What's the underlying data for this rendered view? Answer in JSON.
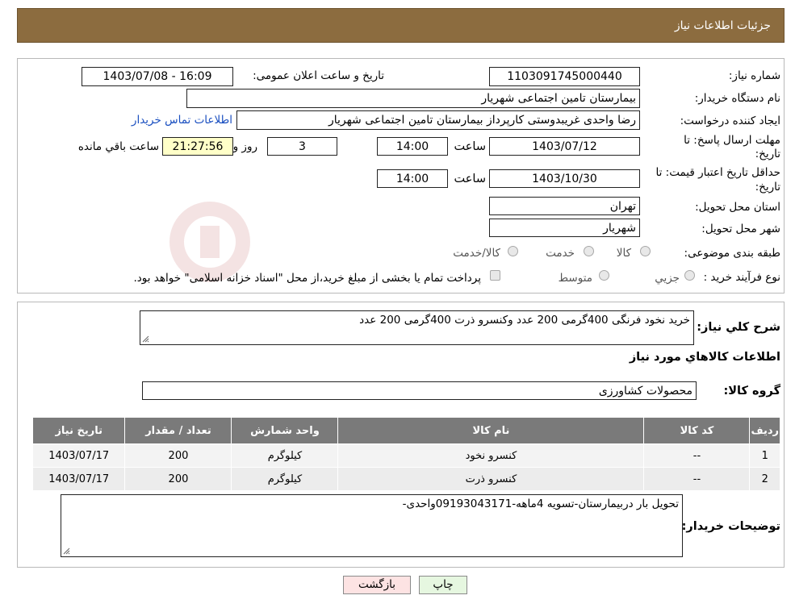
{
  "header": {
    "title": "جزئیات اطلاعات نیاز"
  },
  "form": {
    "need_number_label": "شماره نیاز:",
    "need_number": "1103091745000440",
    "announce_label": "تاریخ و ساعت اعلان عمومی:",
    "announce_value": "1403/07/08 - 16:09",
    "buyer_org_label": "نام دستگاه خریدار:",
    "buyer_org": "بیمارستان تامین اجتماعی شهریار",
    "creator_label": "ایجاد کننده درخواست:",
    "creator": "رضا واحدی غریبدوستی کارپرداز بیمارستان تامین اجتماعی شهریار",
    "contact_link": "اطلاعات تماس خریدار",
    "deadline_label_1": "مهلت ارسال پاسخ: تا",
    "deadline_label_2": "تاریخ:",
    "deadline_date": "1403/07/12",
    "time_label": "ساعت",
    "deadline_time": "14:00",
    "days_value": "3",
    "days_label": "روز و",
    "remaining_time": "21:27:56",
    "remaining_label": "ساعت باقي مانده",
    "validity_label_1": "حداقل تاریخ اعتبار قیمت: تا",
    "validity_label_2": "تاریخ:",
    "validity_date": "1403/10/30",
    "validity_time_label": "ساعت",
    "validity_time": "14:00",
    "province_label": "استان محل تحویل:",
    "province": "تهران",
    "city_label": "شهر محل تحویل:",
    "city": "شهریار",
    "category_label": "طبقه بندی موضوعی:",
    "category_options": [
      "کالا",
      "خدمت",
      "کالا/خدمت"
    ],
    "process_label": "نوع فرآیند خرید :",
    "process_options": [
      "جزيي",
      "متوسط"
    ],
    "process_note": "پرداخت تمام یا بخشی از مبلغ خرید،از محل \"اسناد خزانه اسلامی\" خواهد بود."
  },
  "details": {
    "summary_label": "شرح كلي نياز:",
    "summary": "خرید نخود فرنگی 400گرمی 200 عدد وکنسرو ذرت 400گرمی 200 عدد",
    "goods_info_title": "اطلاعات كالاهاي مورد نياز",
    "goods_group_label": "گروه كالا:",
    "goods_group": "محصولات کشاورزی",
    "table": {
      "headers": [
        "رديف",
        "كد كالا",
        "نام كالا",
        "واحد شمارش",
        "تعداد / مقدار",
        "تاريخ نياز"
      ],
      "rows": [
        [
          "1",
          "--",
          "کنسرو نخود",
          "کیلوگرم",
          "200",
          "1403/07/17"
        ],
        [
          "2",
          "--",
          "کنسرو ذرت",
          "کیلوگرم",
          "200",
          "1403/07/17"
        ]
      ]
    },
    "buyer_notes_label": "توضیحات خریدار:",
    "buyer_notes": "تحویل بار دربیمارستان-تسویه 4ماهه-09193043171واحدی-"
  },
  "buttons": {
    "print": "چاپ",
    "back": "بازگشت"
  },
  "colors": {
    "header_bg": "#8c6c3f",
    "table_header_bg": "#7a7a7a",
    "back_button_bg": "#fde3e3",
    "print_button_bg": "#e6f7e0",
    "remaining_bg": "#ffffc8"
  }
}
